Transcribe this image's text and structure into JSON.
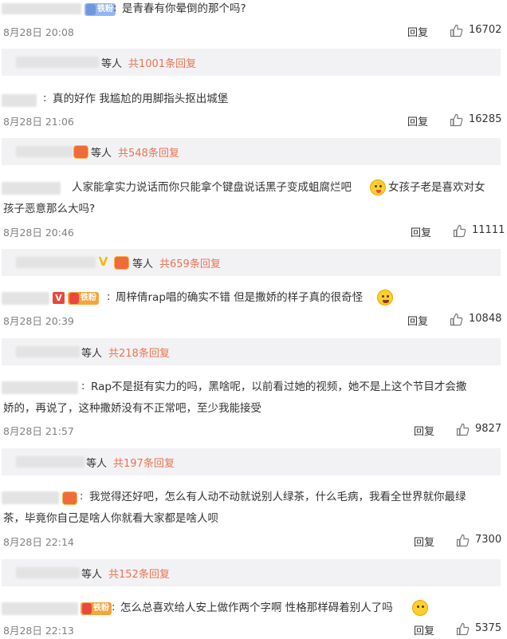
{
  "comments": [
    {
      "badge": "铁粉",
      "text": "是青春有你晕倒的那个吗?",
      "time": "8月28日 20:08",
      "reply_label": "回复",
      "likes": "16702",
      "replies": {
        "etc": "等人",
        "count": "共1001条回复"
      }
    },
    {
      "text": "真的好作  我尴尬的用脚指头抠出城堡",
      "time": "8月28日 21:06",
      "reply_label": "回复",
      "likes": "16285",
      "replies": {
        "etc": "等人",
        "count": "共548条回复"
      }
    },
    {
      "text_line1": "人家能拿实力说话而你只能拿个键盘说话黑子变成蛆腐烂吧",
      "text_line1b": "女孩子老是喜欢对女",
      "text_line2": "孩子恶意那么大吗?",
      "emoji": "tongue-wink-emoji",
      "time": "8月28日 20:46",
      "reply_label": "回复",
      "likes": "11111",
      "replies": {
        "etc": "等人",
        "count": "共659条回复"
      }
    },
    {
      "badge": "铁粉",
      "vip": "V",
      "text": "周梓倩rap唱的确实不错 但是撒娇的样子真的很奇怪",
      "emoji": "laugh-cry-emoji",
      "time": "8月28日 20:39",
      "reply_label": "回复",
      "likes": "10848",
      "replies": {
        "etc": "等人",
        "count": "共218条回复"
      }
    },
    {
      "text_line1": "Rap不是挺有实力的吗，黑啥呢，以前看过她的视频，她不是上这个节目才会撒",
      "text_line2": "娇的，再说了，这种撒娇没有不正常吧，至少我能接受",
      "time": "8月28日 21:57",
      "reply_label": "回复",
      "likes": "9827",
      "replies": {
        "etc": "等人",
        "count": "共197条回复"
      }
    },
    {
      "text_line1": "我觉得还好吧，怎么有人动不动就说别人绿茶，什么毛病，我看全世界就你最绿",
      "text_line2": "茶，毕竟你自己是啥人你就看大家都是啥人呗",
      "time": "8月28日 22:14",
      "reply_label": "回复",
      "likes": "7300",
      "replies": {
        "etc": "等人",
        "count": "共152条回复"
      }
    },
    {
      "badge": "铁粉",
      "text": "怎么总喜欢给人安上做作两个字啊 性格那样碍着别人了吗",
      "emoji": "unamused-emoji",
      "time": "8月28日 22:13",
      "reply_label": "回复",
      "likes": "5375"
    }
  ],
  "colors": {
    "accent": "#eb7350",
    "bar": "#f2f2f5",
    "muted": "#808080"
  }
}
